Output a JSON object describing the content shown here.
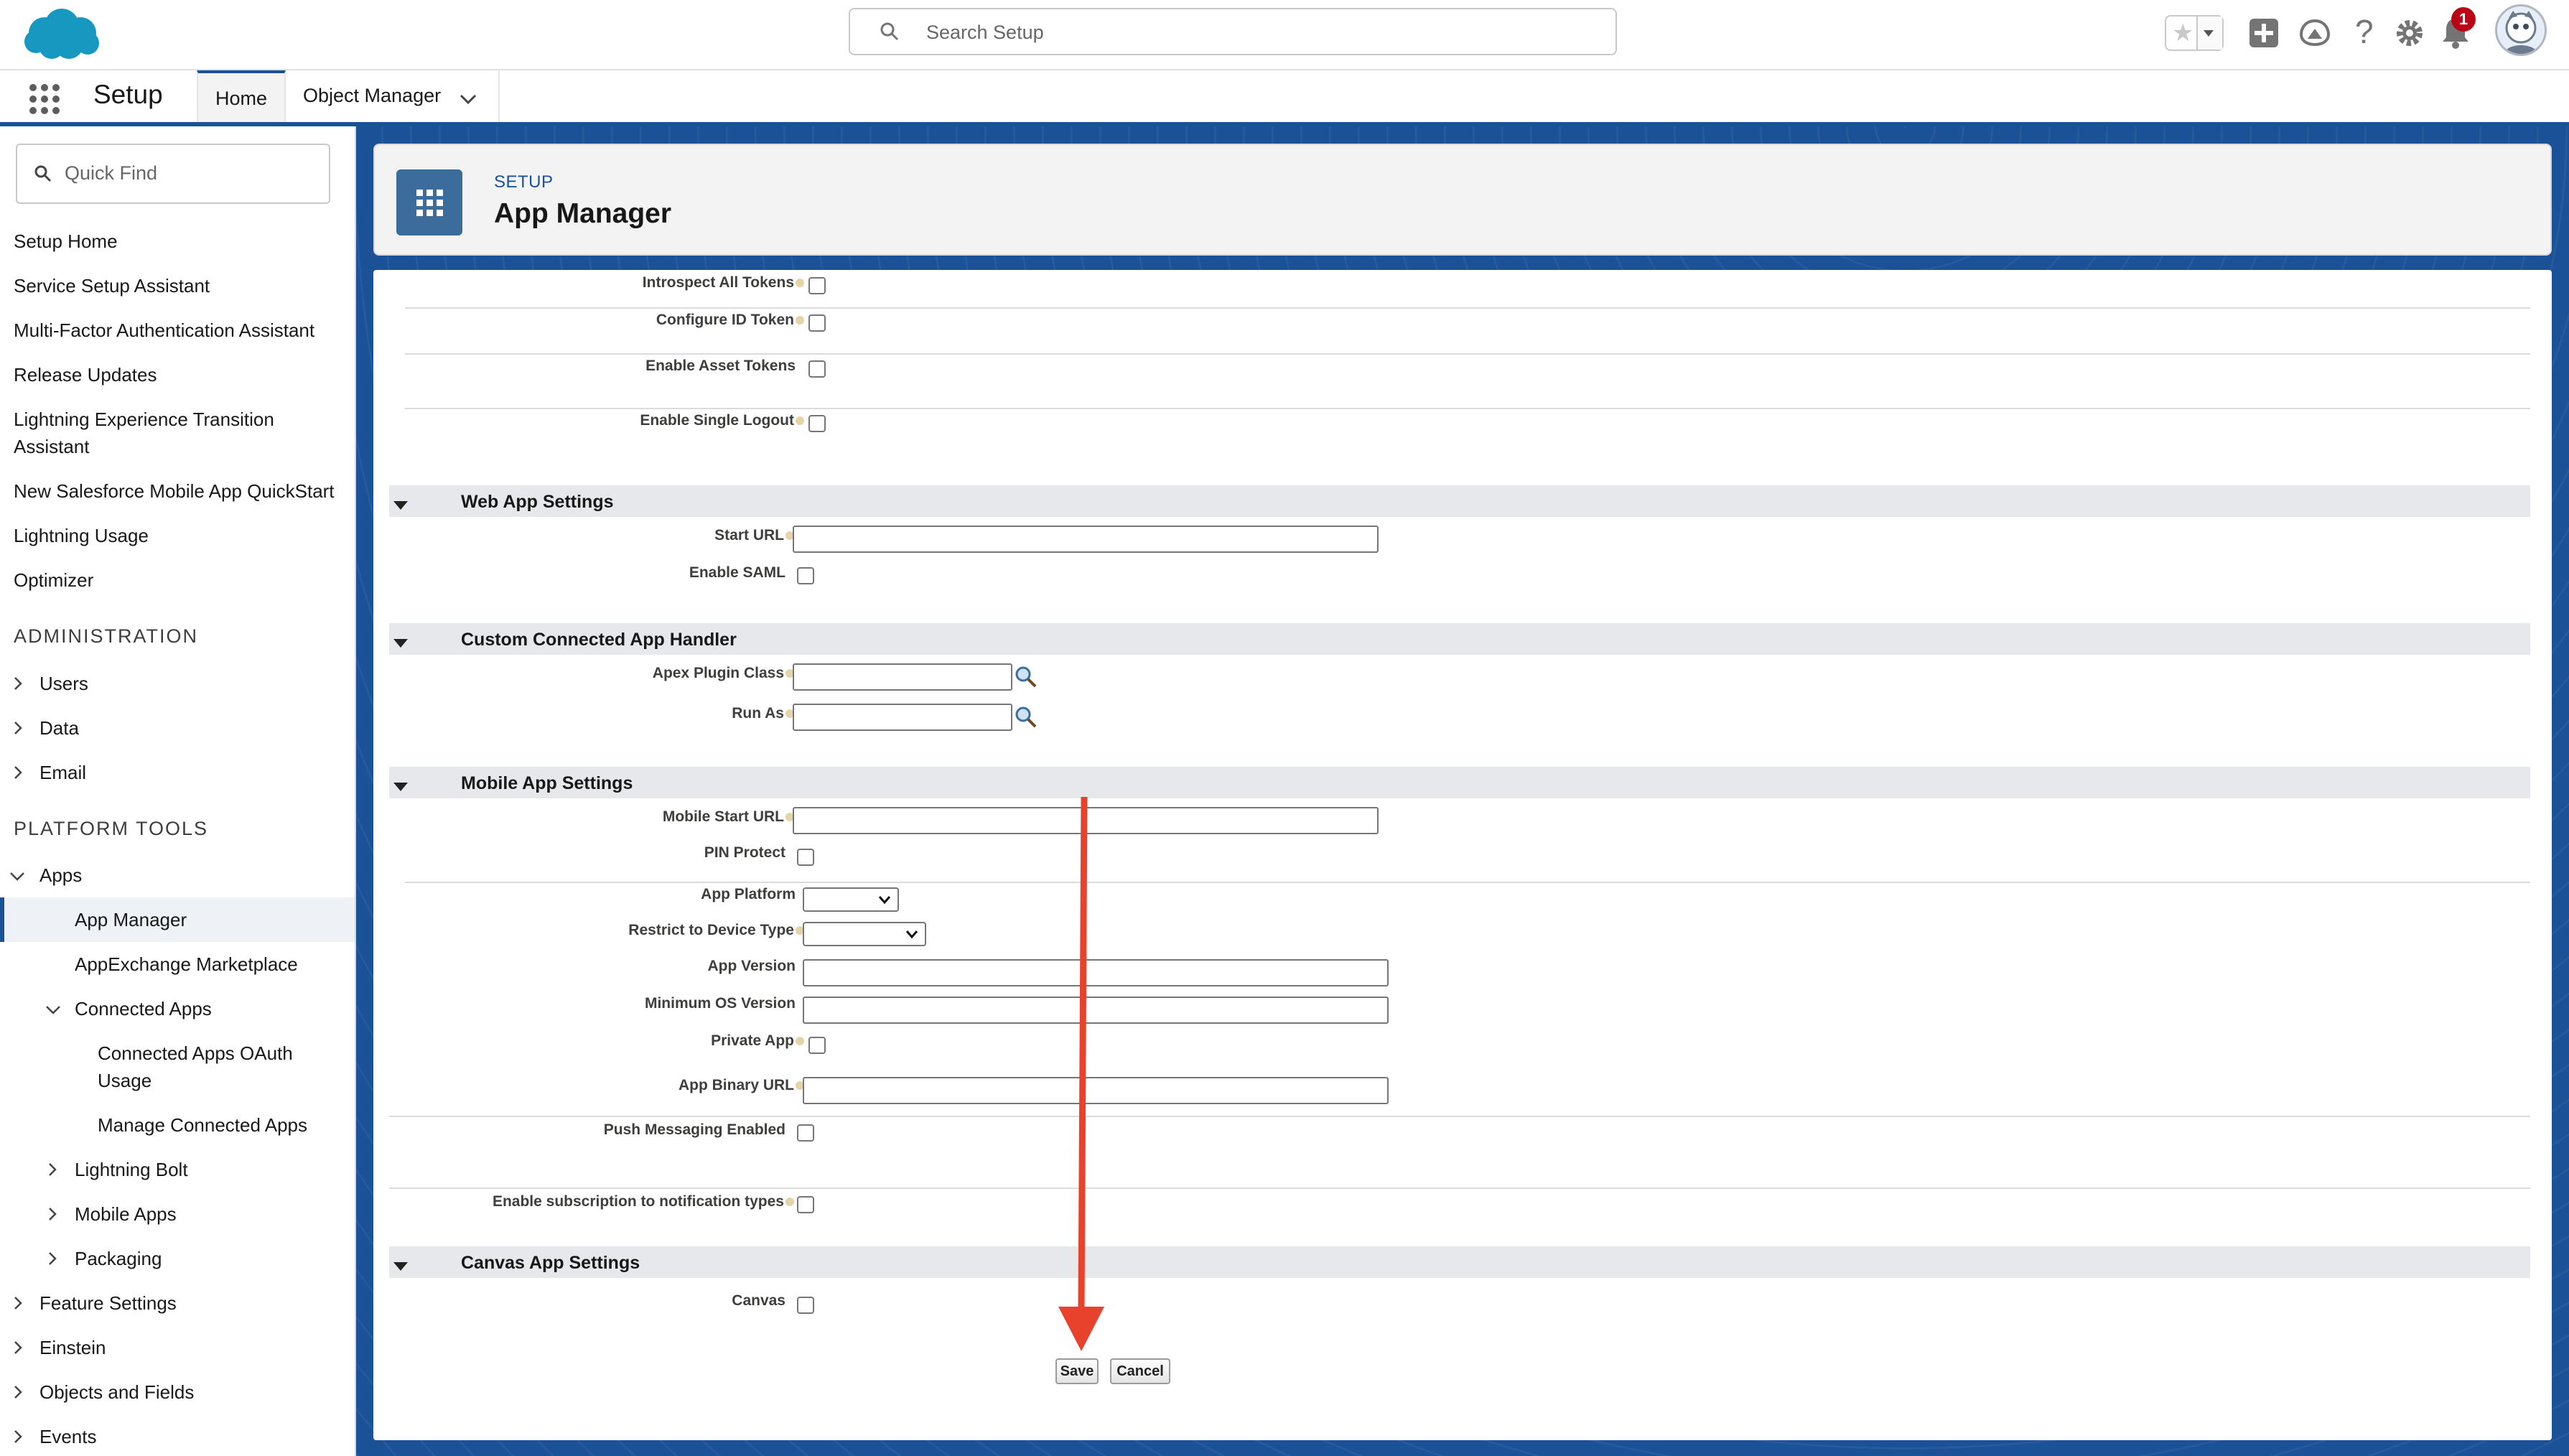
{
  "header": {
    "search_placeholder": "Search Setup",
    "notification_count": "1"
  },
  "nav": {
    "app_name": "Setup",
    "tabs": [
      {
        "label": "Home"
      },
      {
        "label": "Object Manager"
      }
    ]
  },
  "sidebar": {
    "quick_find_placeholder": "Quick Find",
    "top_items": [
      "Setup Home",
      "Service Setup Assistant",
      "Multi-Factor Authentication Assistant",
      "Release Updates",
      "Lightning Experience Transition",
      "Assistant",
      "New Salesforce Mobile App QuickStart",
      "Lightning Usage",
      "Optimizer"
    ],
    "sections": {
      "administration": "ADMINISTRATION",
      "platform_tools": "PLATFORM TOOLS"
    },
    "admin_items": [
      "Users",
      "Data",
      "Email"
    ],
    "platform_items": {
      "apps": "Apps",
      "app_manager": "App Manager",
      "appexchange": "AppExchange Marketplace",
      "connected_apps": "Connected Apps",
      "connected_oauth_1": "Connected Apps OAuth",
      "connected_oauth_2": "Usage",
      "manage_connected": "Manage Connected Apps",
      "lightning_bolt": "Lightning Bolt",
      "mobile_apps": "Mobile Apps",
      "packaging": "Packaging",
      "feature_settings": "Feature Settings",
      "einstein": "Einstein",
      "objects_fields": "Objects and Fields",
      "events": "Events"
    }
  },
  "page": {
    "breadcrumb": "SETUP",
    "title": "App Manager"
  },
  "form": {
    "introspect_tokens": "Introspect All Tokens",
    "configure_id_token": "Configure ID Token",
    "enable_asset_tokens": "Enable Asset Tokens",
    "enable_single_logout": "Enable Single Logout",
    "web_app_section": "Web App Settings",
    "start_url": "Start URL",
    "enable_saml": "Enable SAML",
    "custom_handler_section": "Custom Connected App Handler",
    "apex_plugin_class": "Apex Plugin Class",
    "run_as": "Run As",
    "mobile_section": "Mobile App Settings",
    "mobile_start_url": "Mobile Start URL",
    "pin_protect": "PIN Protect",
    "app_platform": "App Platform",
    "restrict_device_type": "Restrict to Device Type",
    "app_version": "App Version",
    "min_os_version": "Minimum OS Version",
    "private_app": "Private App",
    "app_binary_url": "App Binary URL",
    "push_messaging": "Push Messaging Enabled",
    "enable_subscription": "Enable subscription to notification types",
    "canvas_section": "Canvas App Settings",
    "canvas": "Canvas",
    "save_label": "Save",
    "cancel_label": "Cancel"
  },
  "colors": {
    "brand_blue": "#1b5297",
    "annotation_arrow": "#e8412c",
    "notification_badge": "#ba0517"
  }
}
